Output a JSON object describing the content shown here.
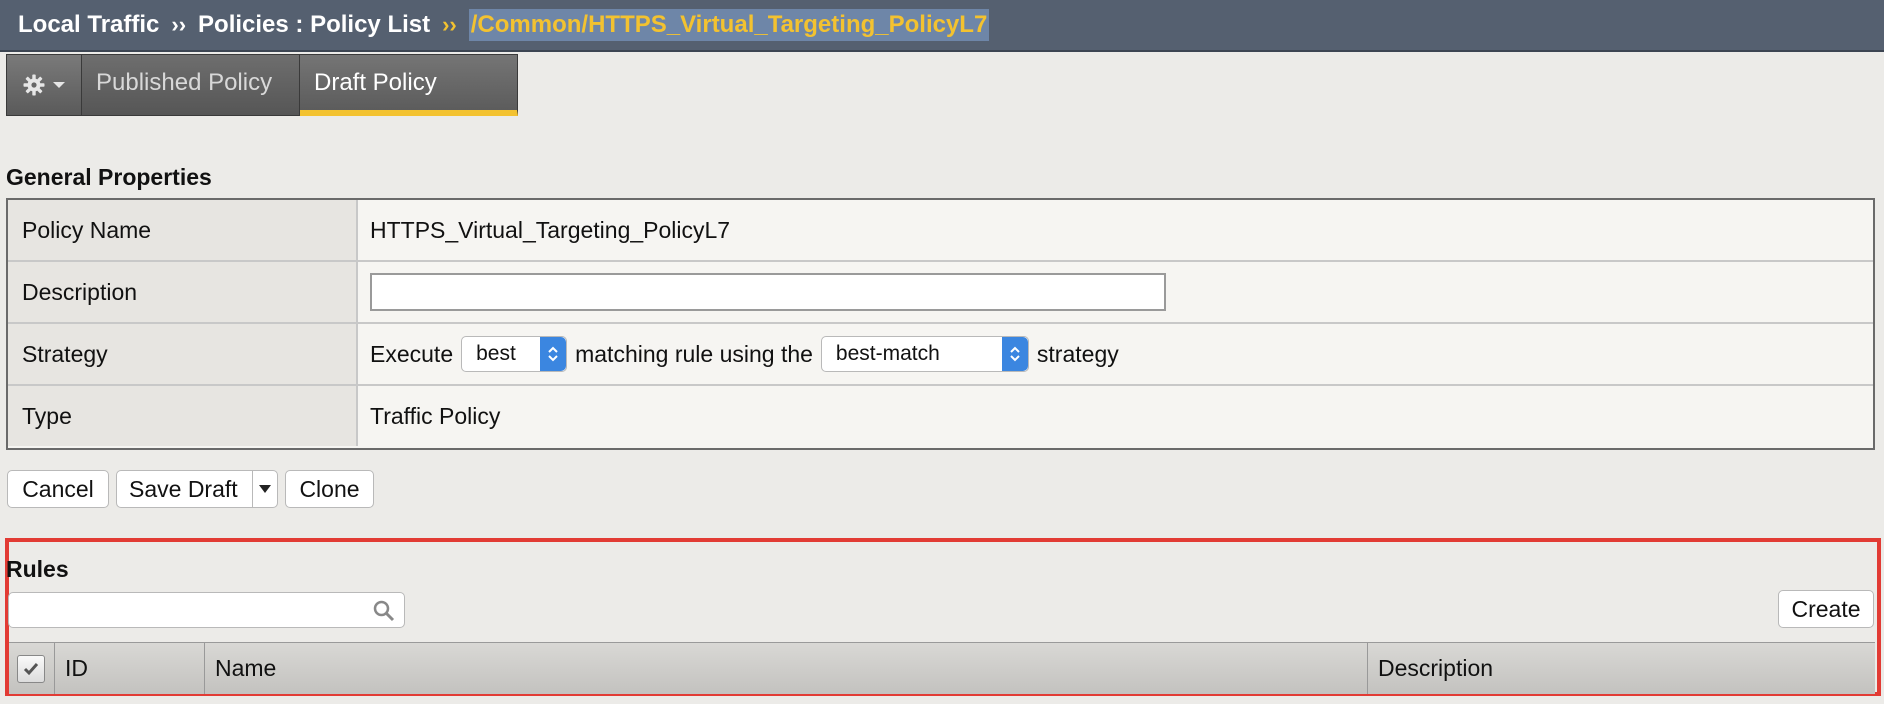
{
  "breadcrumb": {
    "item1": "Local Traffic",
    "sep": "››",
    "item2": "Policies : Policy List",
    "current": "/Common/HTTPS_Virtual_Targeting_PolicyL7"
  },
  "tabs": {
    "gear_icon": "gear-icon",
    "published": "Published Policy",
    "draft": "Draft Policy",
    "active": "Draft Policy"
  },
  "general": {
    "title": "General Properties",
    "rows": {
      "name_label": "Policy Name",
      "name_value": "HTTPS_Virtual_Targeting_PolicyL7",
      "desc_label": "Description",
      "desc_value": "",
      "strategy_label": "Strategy",
      "strategy_prefix": "Execute",
      "strategy_select1": "best",
      "strategy_middle": "matching rule using the",
      "strategy_select2": "best-match",
      "strategy_suffix": "strategy",
      "type_label": "Type",
      "type_value": "Traffic Policy"
    }
  },
  "buttons": {
    "cancel": "Cancel",
    "save_draft": "Save Draft",
    "clone": "Clone"
  },
  "rules": {
    "title": "Rules",
    "search_value": "",
    "create": "Create",
    "columns": [
      "ID",
      "Name",
      "Description"
    ]
  },
  "colors": {
    "header_bg": "#556070",
    "accent_yellow": "#f3c230",
    "highlight_red": "#e23b34",
    "select_blue": "#3b86e0"
  }
}
